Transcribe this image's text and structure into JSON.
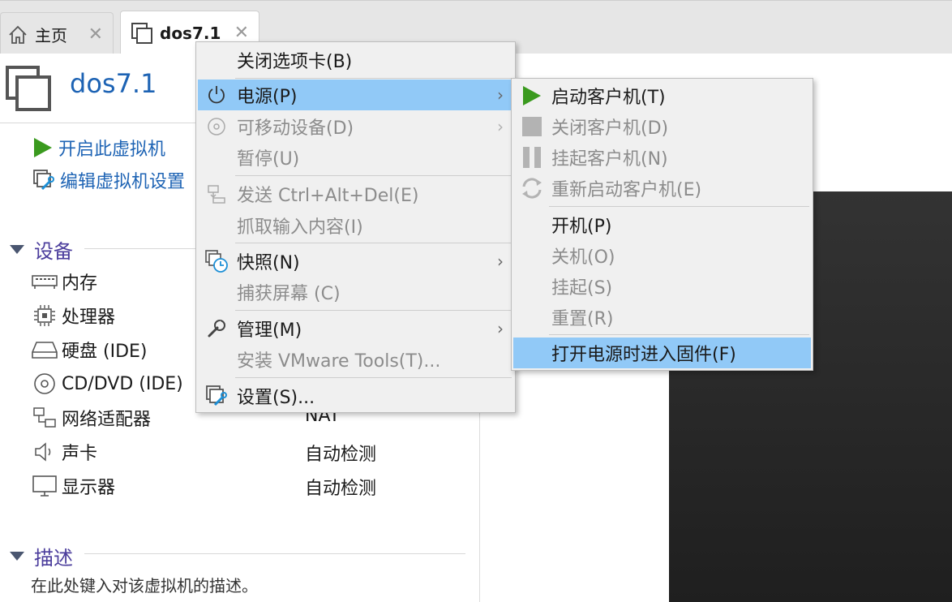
{
  "tabs": [
    {
      "label": "主页",
      "icon": "home-icon"
    },
    {
      "label": "dos7.1",
      "icon": "vm-icon"
    }
  ],
  "vm": {
    "title": "dos7.1",
    "actions": {
      "power_on": "开启此虚拟机",
      "edit_settings": "编辑虚拟机设置"
    }
  },
  "devices": {
    "heading": "设备",
    "items": [
      {
        "name": "内存",
        "value": "",
        "icon": "memory-icon"
      },
      {
        "name": "处理器",
        "value": "",
        "icon": "cpu-icon"
      },
      {
        "name": "硬盘 (IDE)",
        "value": "",
        "icon": "harddisk-icon"
      },
      {
        "name": "CD/DVD (IDE)",
        "value": "",
        "icon": "cd-icon"
      },
      {
        "name": "网络适配器",
        "value": "NAT",
        "icon": "network-icon"
      },
      {
        "name": "声卡",
        "value": "自动检测",
        "icon": "sound-icon"
      },
      {
        "name": "显示器",
        "value": "自动检测",
        "icon": "display-icon"
      }
    ]
  },
  "description": {
    "heading": "描述",
    "placeholder": "在此处键入对该虚拟机的描述。"
  },
  "context_menu": {
    "close_tab": "关闭选项卡(B)",
    "power": "电源(P)",
    "removable": "可移动设备(D)",
    "pause": "暂停(U)",
    "send_cad": "发送 Ctrl+Alt+Del(E)",
    "grab_input": "抓取输入内容(I)",
    "snapshot": "快照(N)",
    "capture_screen": "捕获屏幕 (C)",
    "manage": "管理(M)",
    "install_tools": "安装 VMware Tools(T)...",
    "settings": "设置(S)..."
  },
  "power_submenu": {
    "start_guest": "启动客户机(T)",
    "shutdown_guest": "关闭客户机(D)",
    "suspend_guest": "挂起客户机(N)",
    "restart_guest": "重新启动客户机(E)",
    "power_on": "开机(P)",
    "power_off": "关机(O)",
    "suspend": "挂起(S)",
    "reset": "重置(R)",
    "firmware": "打开电源时进入固件(F)"
  },
  "colors": {
    "accent": "#1d63b4",
    "highlight": "#91c9f7",
    "play_green": "#3a9a1e",
    "section_heading": "#4b3d9c"
  }
}
